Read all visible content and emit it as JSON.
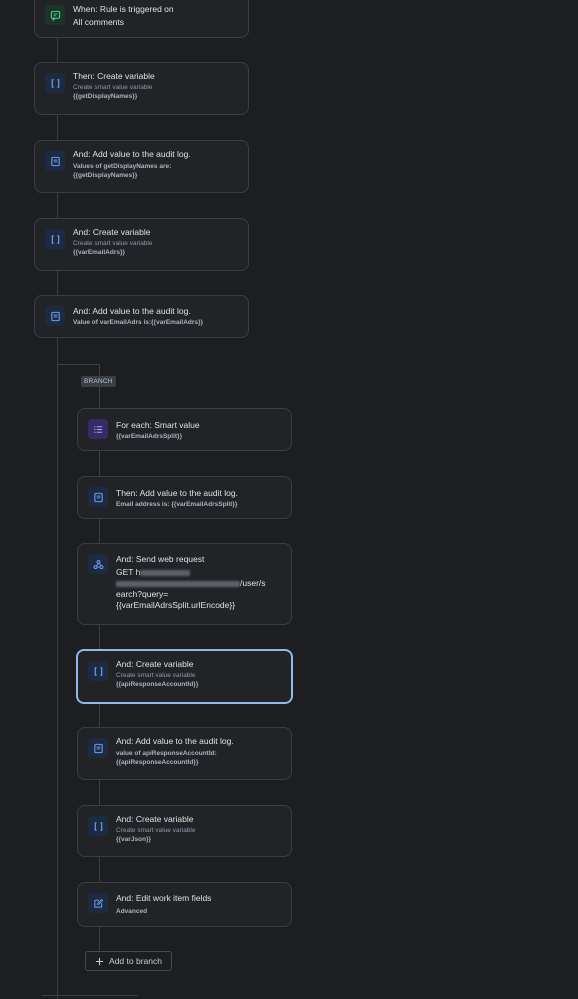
{
  "flow": {
    "trigger": {
      "title": "When: Rule is triggered on",
      "detail": "All comments",
      "icon": "comment-icon"
    },
    "steps": [
      {
        "title": "Then: Create variable",
        "subtitle": "Create smart value variable",
        "detail": "{{getDisplayNames}}",
        "icon": "variable-icon"
      },
      {
        "title": "And: Add value to the audit log.",
        "detail_line1": "Values of getDisplayNames are:",
        "detail_line2": "{{getDisplayNames}}",
        "icon": "audit-log-icon"
      },
      {
        "title": "And: Create variable",
        "subtitle": "Create smart value variable",
        "detail": "{{varEmailAdrs}}",
        "icon": "variable-icon"
      },
      {
        "title": "And: Add value to the audit log.",
        "detail": "Value of varEmailAdrs is:{{varEmailAdrs}}",
        "icon": "audit-log-icon"
      }
    ]
  },
  "branch": {
    "badge": "BRANCH",
    "for_each": {
      "title": "For each: Smart value",
      "detail": "{{varEmailAdrsSplit}}",
      "icon": "list-icon"
    },
    "steps": [
      {
        "title": "Then: Add value to the audit log.",
        "detail": "Email address is: {{varEmailAdrsSplit}}",
        "icon": "audit-log-icon"
      },
      {
        "title": "And: Send web request",
        "line1_prefix": "GET h",
        "line2_suffix": "/user/s",
        "line3": "earch?query=",
        "line4": "{{varEmailAdrsSplit.urlEncode}}",
        "icon": "webhook-icon"
      },
      {
        "title": "And: Create variable",
        "subtitle": "Create smart value variable",
        "detail": "{{apiResponseAccountId}}",
        "icon": "variable-icon"
      },
      {
        "title": "And: Add value to the audit log.",
        "detail_line1": "value of apiResponseAccountId:",
        "detail_line2": "{{apiResponseAccountId}}",
        "icon": "audit-log-icon"
      },
      {
        "title": "And: Create variable",
        "subtitle": "Create smart value variable",
        "detail": "{{varJson}}",
        "icon": "variable-icon"
      },
      {
        "title": "And: Edit work item fields",
        "detail": "Advanced",
        "icon": "edit-icon"
      }
    ],
    "add_button": "Add to branch"
  },
  "colors": {
    "background": "#1d1e21",
    "card": "#222326",
    "border": "#3a3d42",
    "selected_border": "#8fb8ef",
    "icon_blue": "#6f9de8",
    "icon_green": "#4bce97",
    "icon_purple": "#b797f2"
  }
}
